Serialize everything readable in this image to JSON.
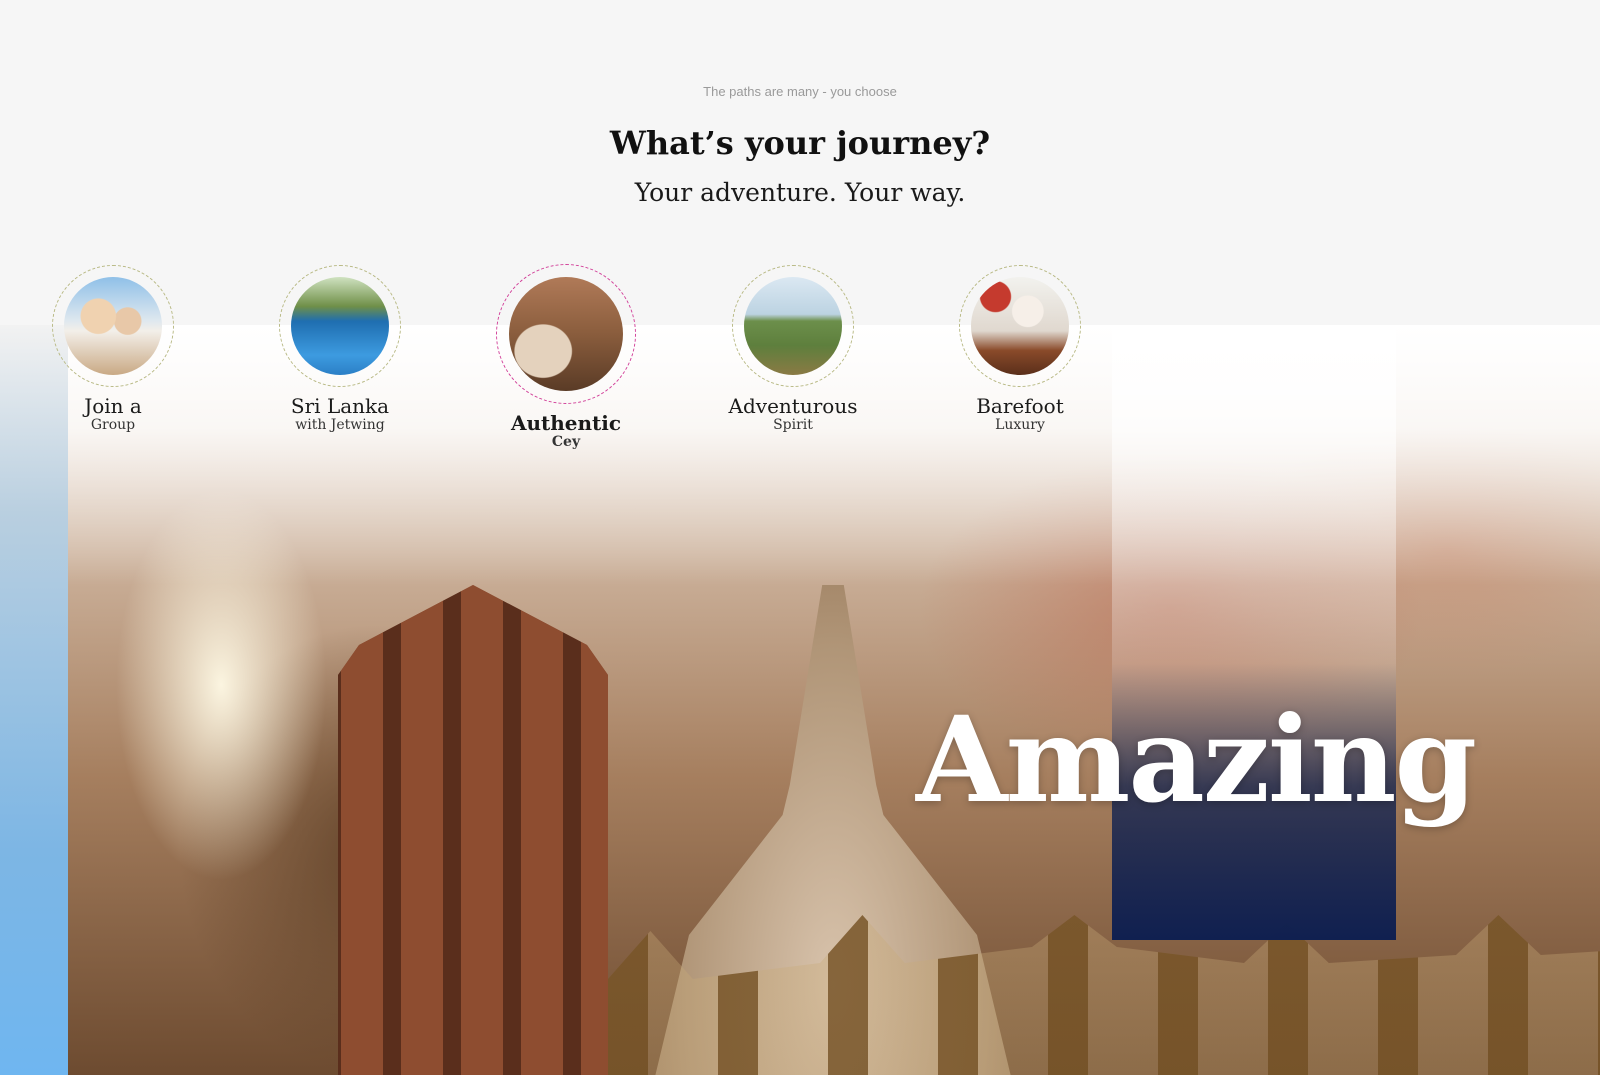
{
  "header": {
    "tagline": "The paths are many - you choose",
    "title": "What’s your journey?",
    "subtitle": "Your adventure. Your way."
  },
  "journeys": [
    {
      "name": "Join a",
      "sub": "Group",
      "selected": false
    },
    {
      "name": "Sri Lanka",
      "sub": "with Jetwing",
      "selected": false
    },
    {
      "name": "Authentic",
      "sub": "Cey",
      "selected": true
    },
    {
      "name": "Adventurous",
      "sub": "Spirit",
      "selected": false
    },
    {
      "name": "Barefoot",
      "sub": "Luxury",
      "selected": false
    }
  ],
  "hero": {
    "word": "Amazing"
  },
  "colors": {
    "accent_selected": "#d2429a",
    "ring_default": "#b9ba86",
    "panel_navy": "#102050",
    "side_strip_blue": "#6fb6f0"
  }
}
